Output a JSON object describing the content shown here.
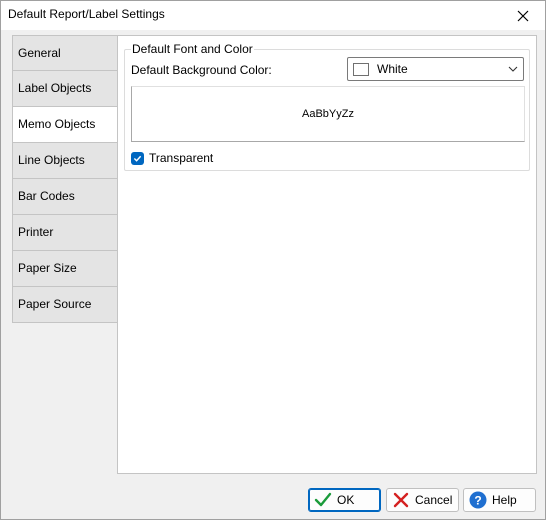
{
  "window": {
    "title": "Default Report/Label Settings"
  },
  "tabs": [
    {
      "label": "General",
      "active": false
    },
    {
      "label": "Label Objects",
      "active": false
    },
    {
      "label": "Memo Objects",
      "active": true
    },
    {
      "label": "Line Objects",
      "active": false
    },
    {
      "label": "Bar Codes",
      "active": false
    },
    {
      "label": "Printer",
      "active": false
    },
    {
      "label": "Paper Size",
      "active": false
    },
    {
      "label": "Paper Source",
      "active": false
    }
  ],
  "font_group": {
    "title": "Default Font and Color",
    "bg_color_label": "Default Background Color:",
    "bg_color_value": "White",
    "bg_color_swatch": "#ffffff",
    "preview_text": "AaBbYyZz",
    "transparent_label": "Transparent",
    "transparent_checked": true
  },
  "footer": {
    "ok_label": "OK",
    "cancel_label": "Cancel",
    "help_label": "Help"
  },
  "colors": {
    "accent": "#0067c0",
    "ok_check": "#1a9b3a",
    "cancel_x": "#d42020",
    "help_circle": "#1f6fd0"
  }
}
